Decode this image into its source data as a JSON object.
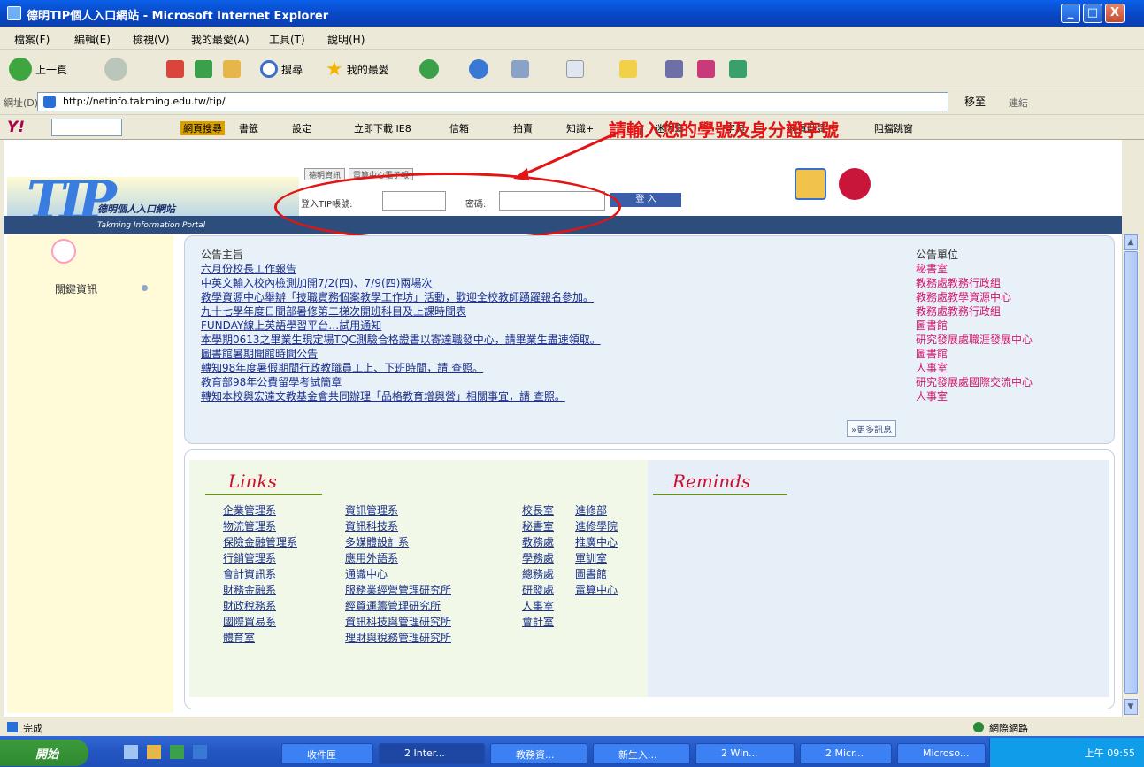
{
  "window": {
    "title": "德明TIP個人入口網站 - Microsoft Internet Explorer",
    "btn_min": "_",
    "btn_max": "□",
    "btn_close": "X"
  },
  "menu": [
    "檔案(F)",
    "編輯(E)",
    "檢視(V)",
    "我的最愛(A)",
    "工具(T)",
    "說明(H)"
  ],
  "toolbar": {
    "back": "上一頁",
    "search": "搜尋",
    "favorites": "我的最愛"
  },
  "address": {
    "label": "網址(D)",
    "url": "http://netinfo.takming.edu.tw/tip/",
    "go": "移至",
    "links": "連結"
  },
  "yahoo": {
    "logo": "Y!",
    "items": [
      "網頁搜尋",
      "書籤",
      "設定",
      "立即下載 IE8",
      "信箱",
      "拍賣",
      "知識+",
      "迷你筆",
      "字典",
      "網頁翻譯",
      "阻擋跳窗"
    ]
  },
  "annotation": {
    "text": "請輸入您的學號及身分證字號"
  },
  "logo": {
    "letters": "TIP",
    "text": "德明個人入口網站",
    "sub": "Takming Information Portal"
  },
  "login": {
    "tabs": [
      "德明資訊",
      "電算中心電子報"
    ],
    "user_label": "登入TIP帳號:",
    "pass_label": "密碼:",
    "submit": "登 入"
  },
  "sidebar": {
    "label": "關鍵資訊"
  },
  "announce": {
    "title": "公告主旨",
    "items": [
      "六月份校長工作報告",
      "中英文輸入校內檢測加開7/2(四)、7/9(四)兩場次",
      "教學資源中心舉辦「技職實務個案教學工作坊」活動，歡迎全校教師踴躍報名參加。",
      "九十七學年度日間部暑修第二梯次開班科目及上課時間表",
      "FUNDAY線上英語學習平台…試用通知",
      "本學期0613之畢業生現定場TQC測驗合格證書以寄達職發中心，請畢業生盡速領取。",
      "圖書館暑期開館時間公告",
      "轉知98年度暑假期間行政教職員工上、下班時間，請 查照。",
      "教育部98年公費留學考試簡章",
      "轉知本校與宏達文教基金會共同辦理「品格教育增與營」相關事宜，請 查照。"
    ],
    "dept_title": "公告單位",
    "depts": [
      "秘書室",
      "教務處教務行政組",
      "教務處教學資源中心",
      "教務處教務行政組",
      "圖書館",
      "研究發展處職涯發展中心",
      "圖書館",
      "人事室",
      "研究發展處國際交流中心",
      "人事室"
    ],
    "more": "»更多訊息"
  },
  "links": {
    "heading": "Links",
    "col1": [
      "企業管理系",
      "物流管理系",
      "保險金融管理系",
      "行銷管理系",
      "會計資訊系",
      "財務金融系",
      "財政稅務系",
      "國際貿易系",
      "體育室"
    ],
    "col2": [
      "資訊管理系",
      "資訊科技系",
      "多媒體設計系",
      "應用外語系",
      "通識中心",
      "服務業經營管理研究所",
      "經貿運籌管理研究所",
      "資訊科技與管理研究所",
      "理財與稅務管理研究所"
    ],
    "col3": [
      "校長室",
      "秘書室",
      "教務處",
      "學務處",
      "總務處",
      "研發處",
      "人事室",
      "會計室"
    ],
    "col4": [
      "進修部",
      "進修學院",
      "推廣中心",
      "軍訓室",
      "圖書館",
      "電算中心"
    ]
  },
  "reminds": {
    "heading": "Reminds"
  },
  "status": {
    "left": "完成",
    "right": "網際網路"
  },
  "taskbar": {
    "start": "開始",
    "tasks": [
      "收件匣",
      "2 Inter...",
      "教務資...",
      "新生入...",
      "2 Win...",
      "2 Micr...",
      "Microso..."
    ],
    "clock": "上午 09:55"
  }
}
